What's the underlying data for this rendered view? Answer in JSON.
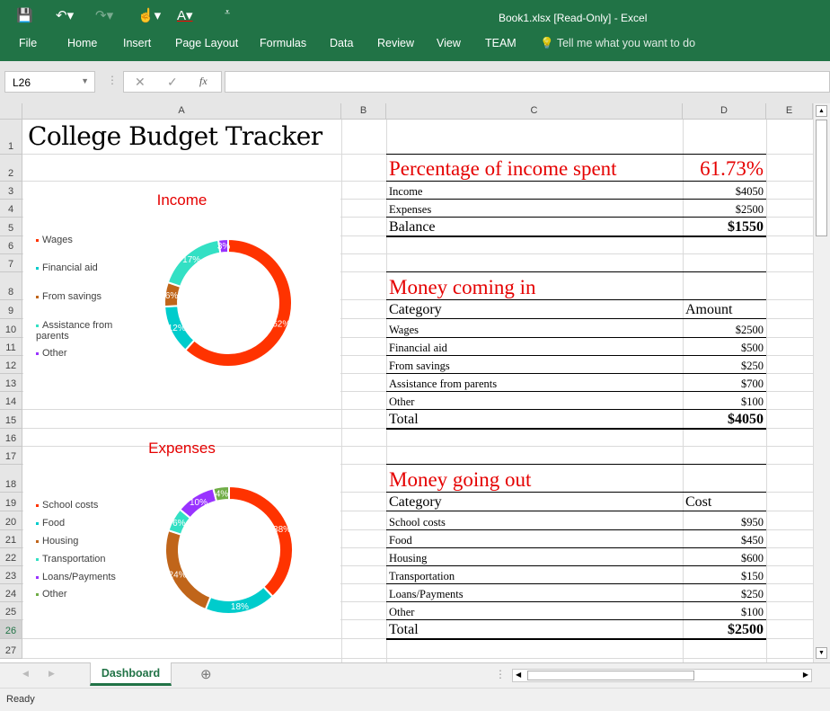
{
  "app": {
    "title": "Book1.xlsx  [Read-Only] - Excel",
    "menu": [
      "File",
      "Home",
      "Insert",
      "Page Layout",
      "Formulas",
      "Data",
      "Review",
      "View",
      "TEAM"
    ],
    "tell_me": "Tell me what you want to do",
    "name_box": "L26",
    "fx": "fx",
    "formula": ""
  },
  "columns": [
    "A",
    "B",
    "C",
    "D",
    "E"
  ],
  "sheet": {
    "title": "College Budget Tracker",
    "pct_label": "Percentage of income spent",
    "pct_value": "61.73%",
    "summary": [
      {
        "label": "Income",
        "value": "$4050"
      },
      {
        "label": "Expenses",
        "value": "$2500"
      },
      {
        "label": "Balance",
        "value": "$1550"
      }
    ],
    "income": {
      "heading": "Money coming in",
      "col1": "Category",
      "col2": "Amount",
      "rows": [
        {
          "label": "Wages",
          "value": "$2500"
        },
        {
          "label": "Financial aid",
          "value": "$500"
        },
        {
          "label": "From savings",
          "value": "$250"
        },
        {
          "label": "Assistance from parents",
          "value": "$700"
        },
        {
          "label": "Other",
          "value": "$100"
        }
      ],
      "total_label": "Total",
      "total_value": "$4050"
    },
    "expenses": {
      "heading": "Money going out",
      "col1": "Category",
      "col2": "Cost",
      "rows": [
        {
          "label": "School costs",
          "value": "$950"
        },
        {
          "label": "Food",
          "value": "$450"
        },
        {
          "label": "Housing",
          "value": "$600"
        },
        {
          "label": "Transportation",
          "value": "$150"
        },
        {
          "label": "Loans/Payments",
          "value": "$250"
        },
        {
          "label": "Other",
          "value": "$100"
        }
      ],
      "total_label": "Total",
      "total_value": "$2500"
    }
  },
  "charts": [
    {
      "title": "Income",
      "type": "donut",
      "legend": [
        "Wages",
        "Financial aid",
        "From savings",
        "Assistance from parents",
        "Other"
      ],
      "values": [
        2500,
        500,
        250,
        700,
        100
      ],
      "labels": [
        "62%",
        "12%",
        "6%",
        "17%",
        "3%"
      ],
      "colors": [
        "#ff3300",
        "#00cccc",
        "#c0651a",
        "#33e0c4",
        "#9933ff"
      ]
    },
    {
      "title": "Expenses",
      "type": "donut",
      "legend": [
        "School costs",
        "Food",
        "Housing",
        "Transportation",
        "Loans/Payments",
        "Other"
      ],
      "values": [
        950,
        450,
        600,
        150,
        250,
        100
      ],
      "labels": [
        "38%",
        "18%",
        "24%",
        "6%",
        "10%",
        "4%"
      ],
      "colors": [
        "#ff3300",
        "#00cccc",
        "#c0651a",
        "#33e0c4",
        "#9933ff",
        "#70ad47"
      ]
    }
  ],
  "tabs": {
    "active": "Dashboard"
  },
  "status": "Ready"
}
